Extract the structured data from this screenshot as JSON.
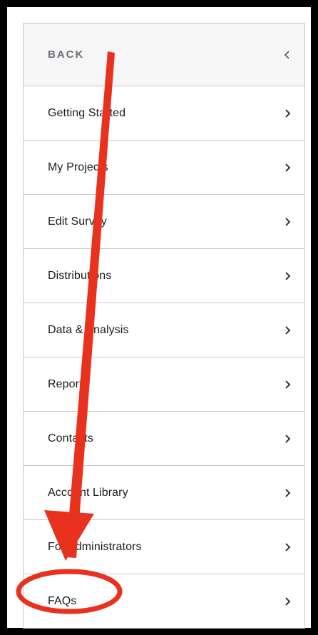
{
  "nav": {
    "back_label": "BACK",
    "items": [
      {
        "label": "Getting Started"
      },
      {
        "label": "My Projects"
      },
      {
        "label": "Edit Survey"
      },
      {
        "label": "Distributions"
      },
      {
        "label": "Data & Analysis"
      },
      {
        "label": "Reports"
      },
      {
        "label": "Contacts"
      },
      {
        "label": "Account Library"
      },
      {
        "label": "For Administrators"
      },
      {
        "label": "FAQs"
      }
    ]
  },
  "icons": {
    "back": "chevron-left-icon",
    "item": "chevron-right-icon"
  },
  "annotation": {
    "color": "#e8321e",
    "highlight_target": "FAQs"
  }
}
